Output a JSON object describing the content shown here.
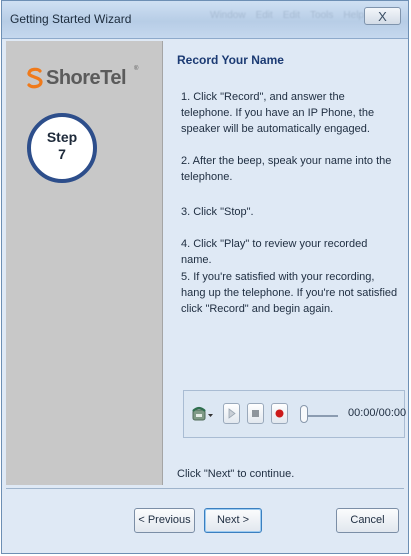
{
  "window": {
    "title": "Getting Started Wizard",
    "close_label": "X"
  },
  "sidebar": {
    "logo_text": "ShoreTel",
    "logo_registered": "®",
    "step_label": "Step",
    "step_number": "7"
  },
  "content": {
    "heading": "Record Your Name",
    "instructions": [
      "1. Click \"Record\", and answer the telephone. If you have an IP Phone, the speaker will be automatically engaged.",
      "2. After the beep, speak your name into the telephone.",
      "3. Click \"Stop\".",
      "4. Click \"Play\" to review your recorded name.",
      "5. If you're satisfied with your recording, hang up the telephone.  If you're not satisfied click \"Record\" and begin again."
    ],
    "continue_hint": "Click \"Next\" to continue."
  },
  "player": {
    "time_display": "00:00/00:00",
    "position_fraction": 0.0,
    "icons": [
      "phone-dropdown-icon",
      "play-icon",
      "stop-icon",
      "record-icon"
    ],
    "record_color": "#cc1a1a"
  },
  "buttons": {
    "previous": "< Previous",
    "next": "Next >",
    "cancel": "Cancel"
  },
  "colors": {
    "window_bg": "#dfe9f5",
    "sidebar_bg": "#c8c8c8",
    "heading": "#1b3a73",
    "step_ring": "#2d4e8b",
    "logo_orange": "#f07a1a"
  }
}
